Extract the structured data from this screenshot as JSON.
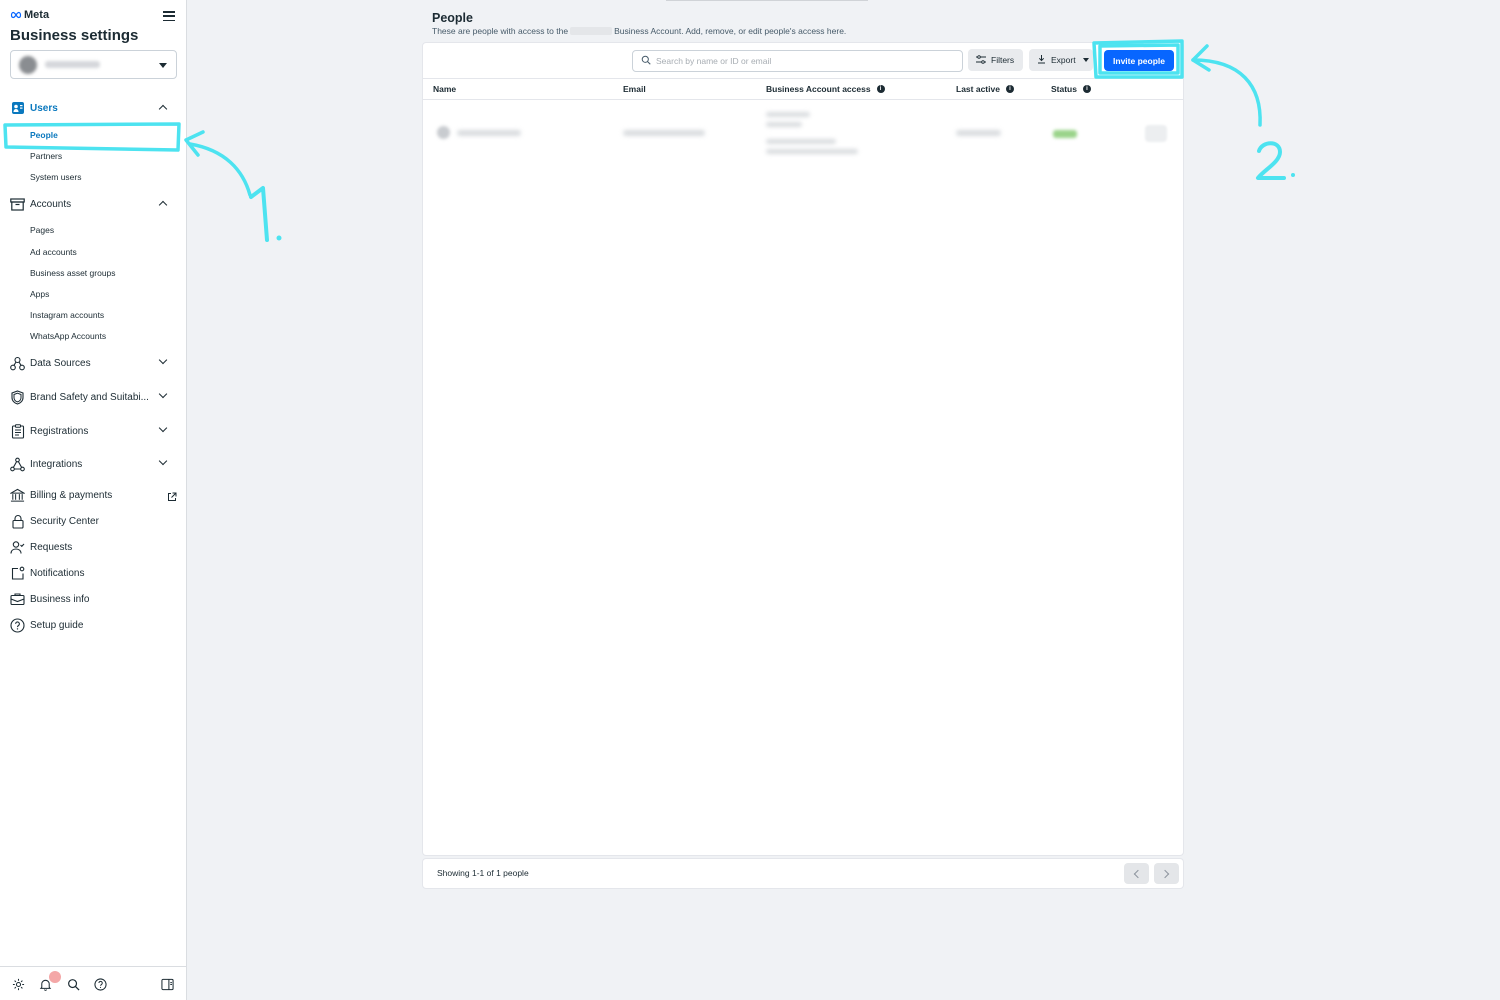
{
  "brand": {
    "logo_text": "Meta",
    "app_title": "Business settings"
  },
  "colors": {
    "accent": "#0866ff",
    "active_nav": "#0a78be",
    "annotation": "#4de3f0",
    "background": "#f0f2f5"
  },
  "sidebar": {
    "users": {
      "label": "Users",
      "icon": "users-icon",
      "expanded": true,
      "items": [
        {
          "label": "People",
          "active": true
        },
        {
          "label": "Partners"
        },
        {
          "label": "System users"
        }
      ]
    },
    "accounts": {
      "label": "Accounts",
      "icon": "archive-box-icon",
      "expanded": true,
      "items": [
        {
          "label": "Pages"
        },
        {
          "label": "Ad accounts"
        },
        {
          "label": "Business asset groups"
        },
        {
          "label": "Apps"
        },
        {
          "label": "Instagram accounts"
        },
        {
          "label": "WhatsApp Accounts"
        }
      ]
    },
    "groups": [
      {
        "label": "Data Sources",
        "icon": "data-sources-icon"
      },
      {
        "label": "Brand Safety and Suitabi...",
        "icon": "shield-icon"
      },
      {
        "label": "Registrations",
        "icon": "clipboard-icon"
      },
      {
        "label": "Integrations",
        "icon": "integrations-icon"
      }
    ],
    "links": [
      {
        "label": "Billing & payments",
        "icon": "bank-icon",
        "external": true
      },
      {
        "label": "Security Center",
        "icon": "lock-icon"
      },
      {
        "label": "Requests",
        "icon": "person-check-icon"
      },
      {
        "label": "Notifications",
        "icon": "notification-icon"
      },
      {
        "label": "Business info",
        "icon": "briefcase-icon"
      },
      {
        "label": "Setup guide",
        "icon": "question-circle-icon"
      }
    ],
    "footer_icons": [
      "gear-icon",
      "bell-icon",
      "search-icon",
      "help-icon",
      "panel-toggle-icon"
    ]
  },
  "main": {
    "title": "People",
    "subtitle_before": "These are people with access to the",
    "subtitle_after": "Business Account. Add, remove, or edit people's access here.",
    "search_placeholder": "Search by name or ID or email",
    "filters_label": "Filters",
    "export_label": "Export",
    "invite_label": "Invite people",
    "columns": [
      "Name",
      "Email",
      "Business Account access",
      "Last active",
      "Status"
    ],
    "showing_text": "Showing 1-1 of 1 people"
  },
  "annotations": [
    "1.",
    "2."
  ]
}
